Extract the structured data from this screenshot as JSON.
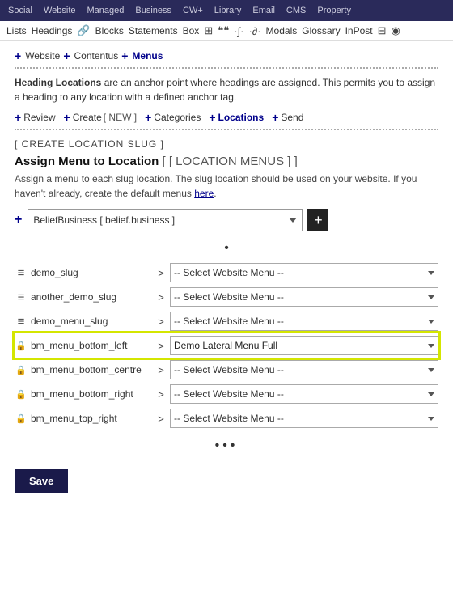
{
  "topnav": {
    "items": [
      "Social",
      "Website",
      "Managed",
      "Business",
      "CW+",
      "Library",
      "Email",
      "CMS",
      "Property"
    ]
  },
  "toolbar": {
    "items": [
      "Lists",
      "Headings",
      "🔗",
      "Blocks",
      "Statements",
      "Box",
      "⊞",
      "❝❝",
      "·∫·",
      "·∂·",
      "Modals",
      "Glossary",
      "InPost",
      "⊟",
      "◉"
    ]
  },
  "navlinks": {
    "website_plus": "+",
    "website": "Website",
    "contentus_plus": "+",
    "contentus": "Contentus",
    "menus_plus": "+",
    "menus": "Menus"
  },
  "info": {
    "heading_locations_label": "Heading Locations",
    "info_text": " are an anchor point where headings are assigned. This permits you to assign a heading to any location with a defined anchor tag."
  },
  "section_nav": {
    "review_plus": "+",
    "review": "Review",
    "create_label": "Create",
    "create_bracket": "[ NEW ]",
    "categories_plus": "+",
    "categories": "Categories",
    "locations_plus": "+",
    "locations": "Locations",
    "send_plus": "+",
    "send": "Send"
  },
  "create_slug": {
    "heading": "[ CREATE LOCATION SLUG ]"
  },
  "assign_menu": {
    "title": "Assign Menu to Location",
    "location_label": "[ [ LOCATION MENUS ] ]",
    "desc": "Assign a menu to each slug location. The slug location should be used on your website. If you haven't already, create the default menus here.",
    "dropdown_value": "BeliefBusiness [ belief.business ]",
    "dropdown_options": [
      "BeliefBusiness [ belief.business ]"
    ],
    "plus": "+",
    "plus_btn": "+"
  },
  "dot": "•",
  "slugs": [
    {
      "icon_type": "drag",
      "name": "demo_slug",
      "arrow": ">",
      "menu_value": "-- Select Website Menu --",
      "highlighted": false
    },
    {
      "icon_type": "drag",
      "name": "another_demo_slug",
      "arrow": ">",
      "menu_value": "-- Select Website Menu --",
      "highlighted": false
    },
    {
      "icon_type": "drag",
      "name": "demo_menu_slug",
      "arrow": ">",
      "menu_value": "-- Select Website Menu --",
      "highlighted": false
    },
    {
      "icon_type": "lock",
      "name": "bm_menu_bottom_left",
      "arrow": ">",
      "menu_value": "Demo Lateral Menu Full",
      "highlighted": true
    },
    {
      "icon_type": "lock",
      "name": "bm_menu_bottom_centre",
      "arrow": ">",
      "menu_value": "-- Select Website Menu --",
      "highlighted": false
    },
    {
      "icon_type": "lock",
      "name": "bm_menu_bottom_right",
      "arrow": ">",
      "menu_value": "-- Select Website Menu --",
      "highlighted": false
    },
    {
      "icon_type": "lock",
      "name": "bm_menu_top_right",
      "arrow": ">",
      "menu_value": "-- Select Website Menu --",
      "highlighted": false
    }
  ],
  "triple_dot": "•••",
  "save_button": "Save"
}
